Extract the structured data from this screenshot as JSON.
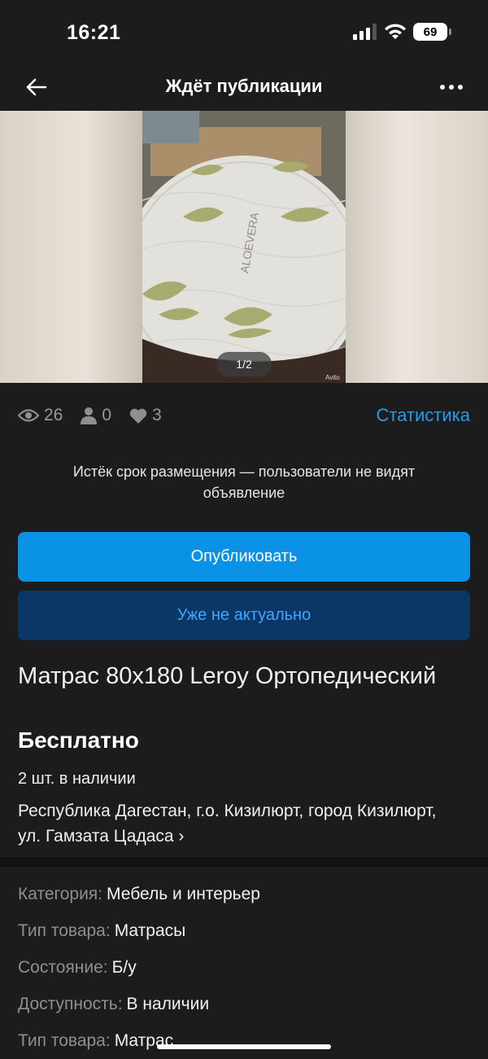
{
  "status_bar": {
    "time": "16:21",
    "battery": "69"
  },
  "nav": {
    "title": "Ждёт публикации"
  },
  "gallery": {
    "pager": "1/2",
    "watermark": "Avito",
    "photo_text": "ALOEVERA"
  },
  "stats": {
    "views": "26",
    "contacts": "0",
    "favorites": "3",
    "link": "Статистика"
  },
  "notice": "Истёк срок размещения — пользователи не видят объявление",
  "buttons": {
    "publish": "Опубликовать",
    "outdated": "Уже не актуально"
  },
  "item": {
    "title": "Матрас 80х180 Leroy Ортопедический",
    "price": "Бесплатно",
    "stock": "2 шт. в наличии",
    "address": "Республика Дагестан, г.о. Кизилюрт, город Кизилюрт, ул. Гамзата Цадаса",
    "address_chevron": "›"
  },
  "params": [
    {
      "key": "Категория:",
      "value": "Мебель и интерьер"
    },
    {
      "key": "Тип товара:",
      "value": "Матрасы"
    },
    {
      "key": "Состояние:",
      "value": "Б/у"
    },
    {
      "key": "Доступность:",
      "value": "В наличии"
    },
    {
      "key": "Тип товара:",
      "value": "Матрас"
    }
  ],
  "colors": {
    "accent": "#0a93e6",
    "link": "#1e9cf0",
    "secondary_button": "#0a3765"
  }
}
